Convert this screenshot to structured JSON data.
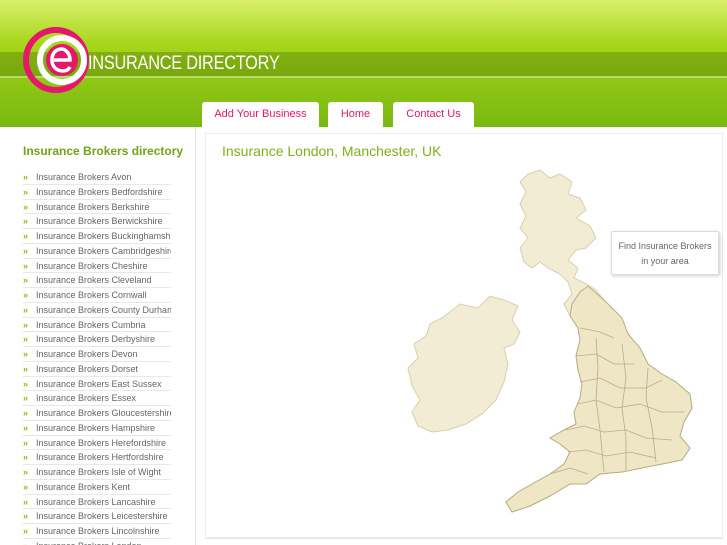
{
  "header": {
    "site_title": "INSURANCE DIRECTORY",
    "tabs": [
      {
        "label": "Add Your Business"
      },
      {
        "label": "Home"
      },
      {
        "label": "Contact Us"
      }
    ]
  },
  "sidebar": {
    "title": "Insurance Brokers directory",
    "items": [
      "Insurance Brokers Avon",
      "Insurance Brokers Bedfordshire",
      "Insurance Brokers Berkshire",
      "Insurance Brokers Berwickshire",
      "Insurance Brokers Buckinghamshire",
      "Insurance Brokers Cambridgeshire",
      "Insurance Brokers Cheshire",
      "Insurance Brokers Cleveland",
      "Insurance Brokers Cornwall",
      "Insurance Brokers County Durham",
      "Insurance Brokers Cumbria",
      "Insurance Brokers Derbyshire",
      "Insurance Brokers Devon",
      "Insurance Brokers Dorset",
      "Insurance Brokers East Sussex",
      "Insurance Brokers Essex",
      "Insurance Brokers Gloucestershire",
      "Insurance Brokers Hampshire",
      "Insurance Brokers Herefordshire",
      "Insurance Brokers Hertfordshire",
      "Insurance Brokers Isle of Wight",
      "Insurance Brokers Kent",
      "Insurance Brokers Lancashire",
      "Insurance Brokers Leicestershire",
      "Insurance Brokers Lincolnshire",
      "Insurance Brokers London"
    ]
  },
  "main": {
    "title": "Insurance London, Manchester, UK",
    "find_box": {
      "line1": "Find Insurance Brokers",
      "line2": "in your area"
    }
  },
  "colors": {
    "brand_green": "#8cc414",
    "accent_pink": "#e4176b",
    "title_green": "#7fb01a"
  }
}
